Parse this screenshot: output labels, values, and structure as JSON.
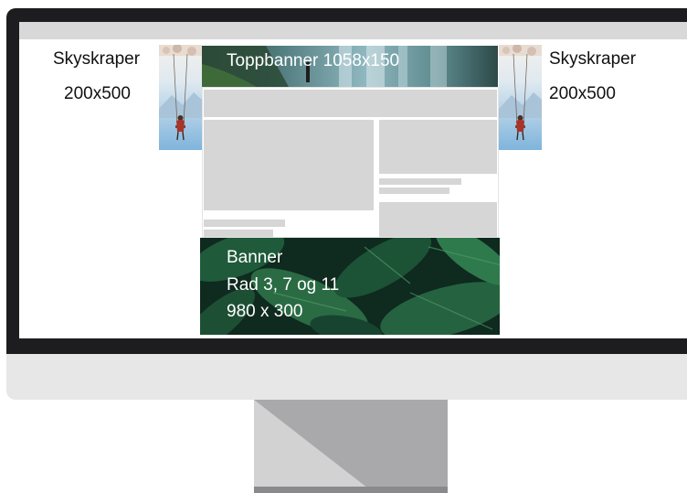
{
  "skyscraper_left": {
    "title": "Skyskraper",
    "size": "200x500"
  },
  "skyscraper_right": {
    "title": "Skyskraper",
    "size": "200x500"
  },
  "top_banner": {
    "label": "Toppbanner 1058x150"
  },
  "banner": {
    "line1": "Banner",
    "line2": "Rad 3, 7 og 11",
    "line3": "980 x 300"
  },
  "colors": {
    "bezel": "#1d1d1f",
    "chin": "#e7e7e7",
    "placeholder": "#d6d6d6",
    "waterfall": "#4f7a7c",
    "foliage": "#1f5a3a"
  },
  "icons": {
    "skyscraper_image": "swing-photo",
    "top_banner_image": "waterfall-photo",
    "banner_image": "tropical-leaves-photo"
  }
}
